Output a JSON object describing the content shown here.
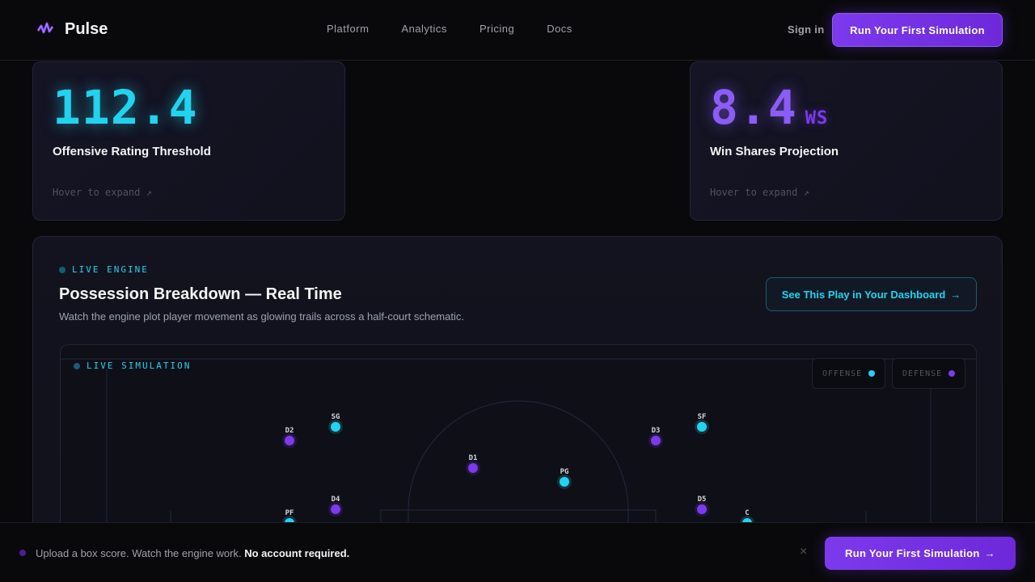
{
  "nav": {
    "brand": "Pulse",
    "links": [
      "Platform",
      "Analytics",
      "Pricing",
      "Docs"
    ],
    "signin": "Sign in",
    "cta": "Run Your First Simulation"
  },
  "stats": [
    {
      "value": "112.4",
      "unit": "",
      "label": "Offensive Rating Threshold",
      "hint": "Hover to expand ↗",
      "color": "#22d3ee"
    },
    {
      "value": "8.4",
      "unit": "WS",
      "label": "Win Shares Projection",
      "hint": "Hover to expand ↗",
      "color": "#8b5cf6"
    }
  ],
  "engine": {
    "tag": "LIVE ENGINE",
    "title": "Possession Breakdown — Real Time",
    "subtitle": "Watch the engine plot player movement as glowing trails across a half-court schematic.",
    "button": "See This Play in Your Dashboard",
    "button_arrow": "→",
    "sim": {
      "tag": "LIVE SIMULATION",
      "legend": [
        {
          "label": "OFFENSE",
          "color": "#22d3ee"
        },
        {
          "label": "DEFENSE",
          "color": "#7c3aed"
        }
      ],
      "players": [
        {
          "id": "SG",
          "team": "offense"
        },
        {
          "id": "D2",
          "team": "defense"
        },
        {
          "id": "D1",
          "team": "defense"
        },
        {
          "id": "PG",
          "team": "offense"
        },
        {
          "id": "D3",
          "team": "defense"
        },
        {
          "id": "SF",
          "team": "offense"
        },
        {
          "id": "D4",
          "team": "defense"
        },
        {
          "id": "PF",
          "team": "offense"
        },
        {
          "id": "D5",
          "team": "defense"
        },
        {
          "id": "C",
          "team": "offense"
        }
      ]
    }
  },
  "bottombar": {
    "text": "Upload a box score. Watch the engine work.",
    "bold": "No account required.",
    "close": "×",
    "cta": "Run Your First Simulation",
    "cta_arrow": "→"
  },
  "colors": {
    "accent": "#7c3aed",
    "cyan": "#22d3ee",
    "background": "#09090b"
  }
}
